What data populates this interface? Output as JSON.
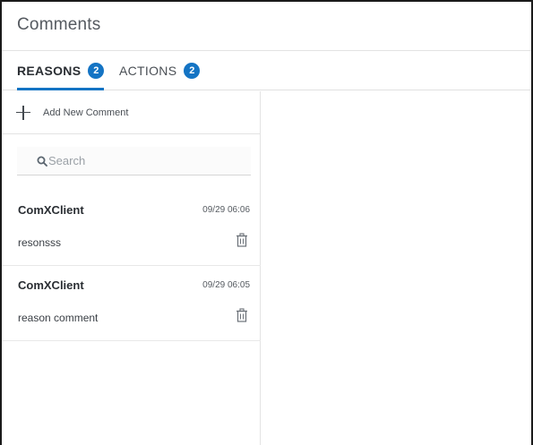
{
  "header": {
    "title": "Comments"
  },
  "tabs": [
    {
      "label": "REASONS",
      "count": "2",
      "active": true
    },
    {
      "label": "ACTIONS",
      "count": "2",
      "active": false
    }
  ],
  "toolbar": {
    "add_label": "Add New Comment",
    "add_icon": "plus-icon"
  },
  "search": {
    "placeholder": "Search",
    "value": "",
    "icon": "search-icon"
  },
  "comments": [
    {
      "author": "ComXClient",
      "timestamp": "09/29 06:06",
      "text": "resonsss",
      "delete_icon": "trash-icon"
    },
    {
      "author": "ComXClient",
      "timestamp": "09/29 06:05",
      "text": "reason comment",
      "delete_icon": "trash-icon"
    }
  ],
  "colors": {
    "accent": "#1474c4",
    "border": "#e3e3e3",
    "text": "#333333"
  }
}
